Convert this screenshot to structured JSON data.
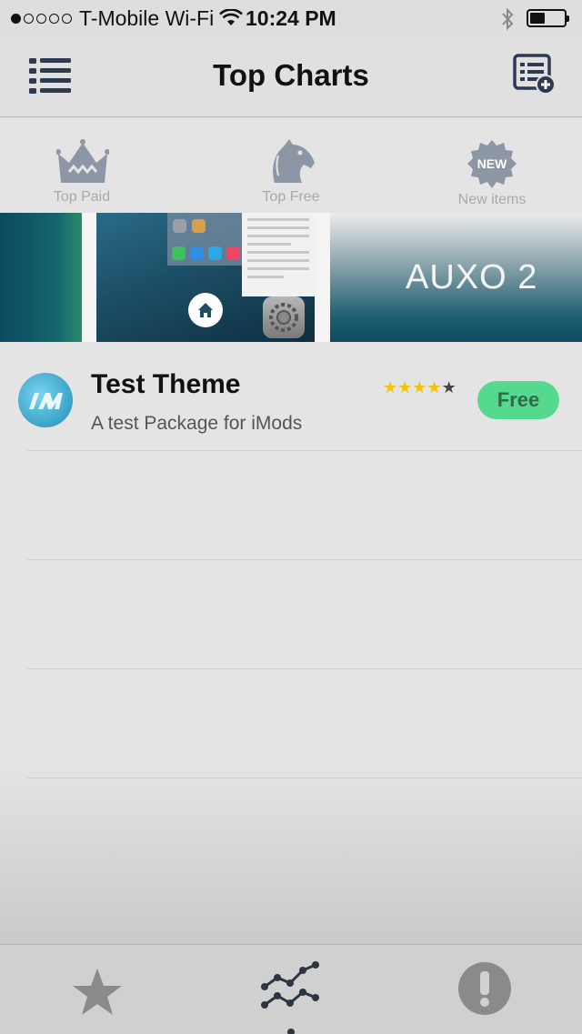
{
  "status_bar": {
    "carrier": "T-Mobile Wi-Fi",
    "time": "10:24 PM",
    "signal_dots_filled": 1,
    "signal_dots_total": 5,
    "battery_level_percent": 40
  },
  "nav": {
    "title": "Top Charts",
    "left_icon": "list-icon",
    "right_icon": "add-to-list-icon"
  },
  "tabs": [
    {
      "label": "Top Paid",
      "icon": "crown-icon"
    },
    {
      "label": "Top Free",
      "icon": "horse-icon"
    },
    {
      "label": "New items",
      "icon": "new-badge-icon",
      "badge_text": "NEW"
    }
  ],
  "banner": {
    "right_text": "AUXO 2"
  },
  "packages": [
    {
      "name": "Test Theme",
      "description": "A test Package for iMods",
      "rating": 4,
      "rating_max": 5,
      "price_label": "Free"
    }
  ],
  "tabbar": [
    {
      "icon": "star-icon"
    },
    {
      "icon": "chart-icon"
    },
    {
      "icon": "alert-icon"
    }
  ],
  "colors": {
    "accent_green": "#55d98e",
    "icon_dark": "#2d3a52",
    "star_gold": "#f4c20d"
  }
}
